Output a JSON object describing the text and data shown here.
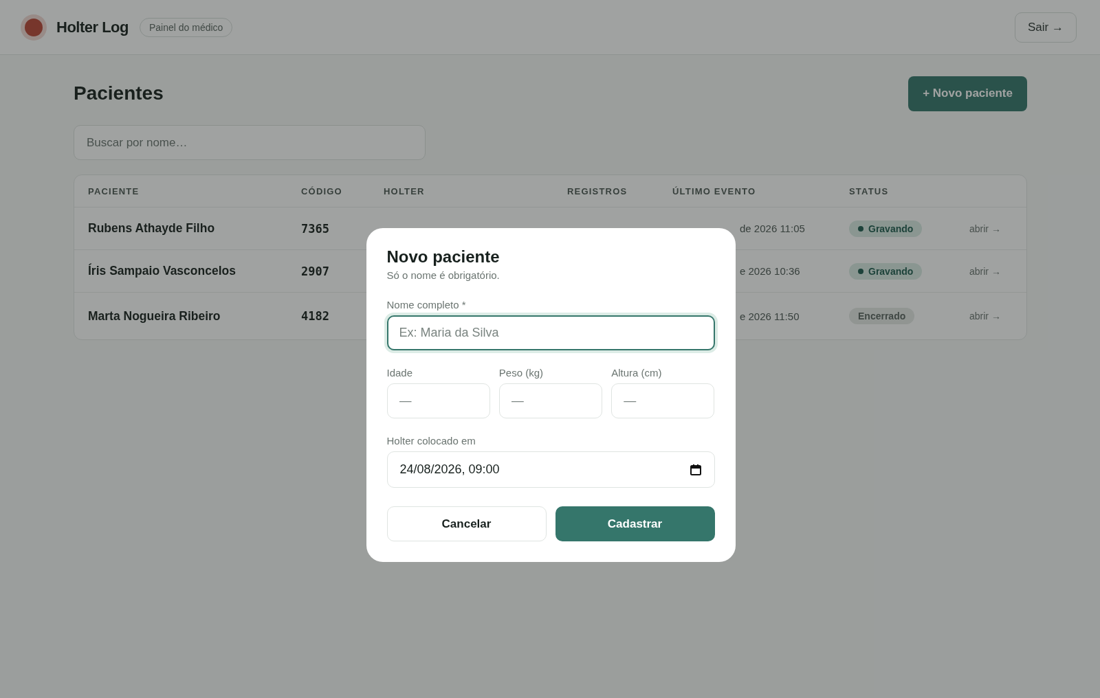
{
  "header": {
    "app_name": "Holter Log",
    "badge": "Painel do médico",
    "logout_button": "Sair →"
  },
  "page": {
    "title": "Pacientes",
    "new_button": "+ Novo paciente",
    "search": {
      "placeholder": "Buscar por nome…"
    }
  },
  "table": {
    "columns": [
      "PACIENTE",
      "CÓDIGO",
      "HOLTER",
      "REGISTROS",
      "ÚLTIMO EVENTO",
      "STATUS"
    ],
    "rows": [
      {
        "name": "Rubens Athayde Filho",
        "code": "7365",
        "last_event": "de 2026 11:05",
        "status": {
          "label": "Gravando",
          "kind": "recording"
        },
        "action": "abrir →"
      },
      {
        "name": "Íris Sampaio Vasconcelos",
        "code": "2907",
        "last_event": "e 2026 10:36",
        "status": {
          "label": "Gravando",
          "kind": "recording"
        },
        "action": "abrir →"
      },
      {
        "name": "Marta Nogueira Ribeiro",
        "code": "4182",
        "last_event": "e 2026 11:50",
        "status": {
          "label": "Encerrado",
          "kind": "ended"
        },
        "action": "abrir →"
      }
    ]
  },
  "modal": {
    "title": "Novo paciente",
    "subtitle": "Só o nome é obrigatório.",
    "name_field": {
      "label": "Nome completo *",
      "placeholder": "Ex: Maria da Silva",
      "focused": true
    },
    "fields": [
      {
        "label": "Idade",
        "placeholder": "—"
      },
      {
        "label": "Peso (kg)",
        "placeholder": "—"
      },
      {
        "label": "Altura (cm)",
        "placeholder": "—"
      }
    ],
    "date_field": {
      "label": "Holter colocado em",
      "value": "24/08/2026, 09:00"
    },
    "cancel_button": "Cancelar",
    "submit_button": "Cadastrar"
  }
}
